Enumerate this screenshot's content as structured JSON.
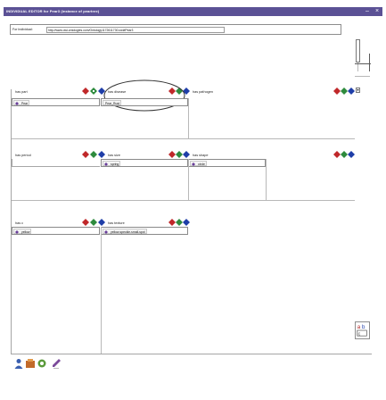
{
  "window": {
    "title": "INDIVIDUAL EDITOR for Pear3  (instance of peartree)",
    "minimize": "–",
    "close": "×"
  },
  "url_field": {
    "label": "For Individual:",
    "value": "http://www.owl-ontologies.com/Ontology1172611730.owl#Pear3"
  },
  "rows": [
    {
      "left_label": "has part",
      "value_chip": "Pear",
      "mid_label": "has disease",
      "mid_chip": "Pear_Rust",
      "right_label": "has pathogen"
    },
    {
      "left_label": "has period",
      "mid_label": "has size",
      "mid_chip": "spring",
      "right_label": "has shape",
      "right_chip": "circle"
    },
    {
      "left_label": "has c",
      "value_chip": "yellow",
      "mid_label": "has texture",
      "mid_chip": "yellow-speckle-small-spot"
    }
  ],
  "side_tool_icon": "abc-spellcheck-icon",
  "colors": {
    "titlebar": "#5b5195",
    "icon_red": "#c0282a",
    "icon_blue": "#1f3ea8",
    "icon_green": "#2e8b3d",
    "icon_purple": "#6a3f9a",
    "chip_bg": "#f5f5f5"
  }
}
